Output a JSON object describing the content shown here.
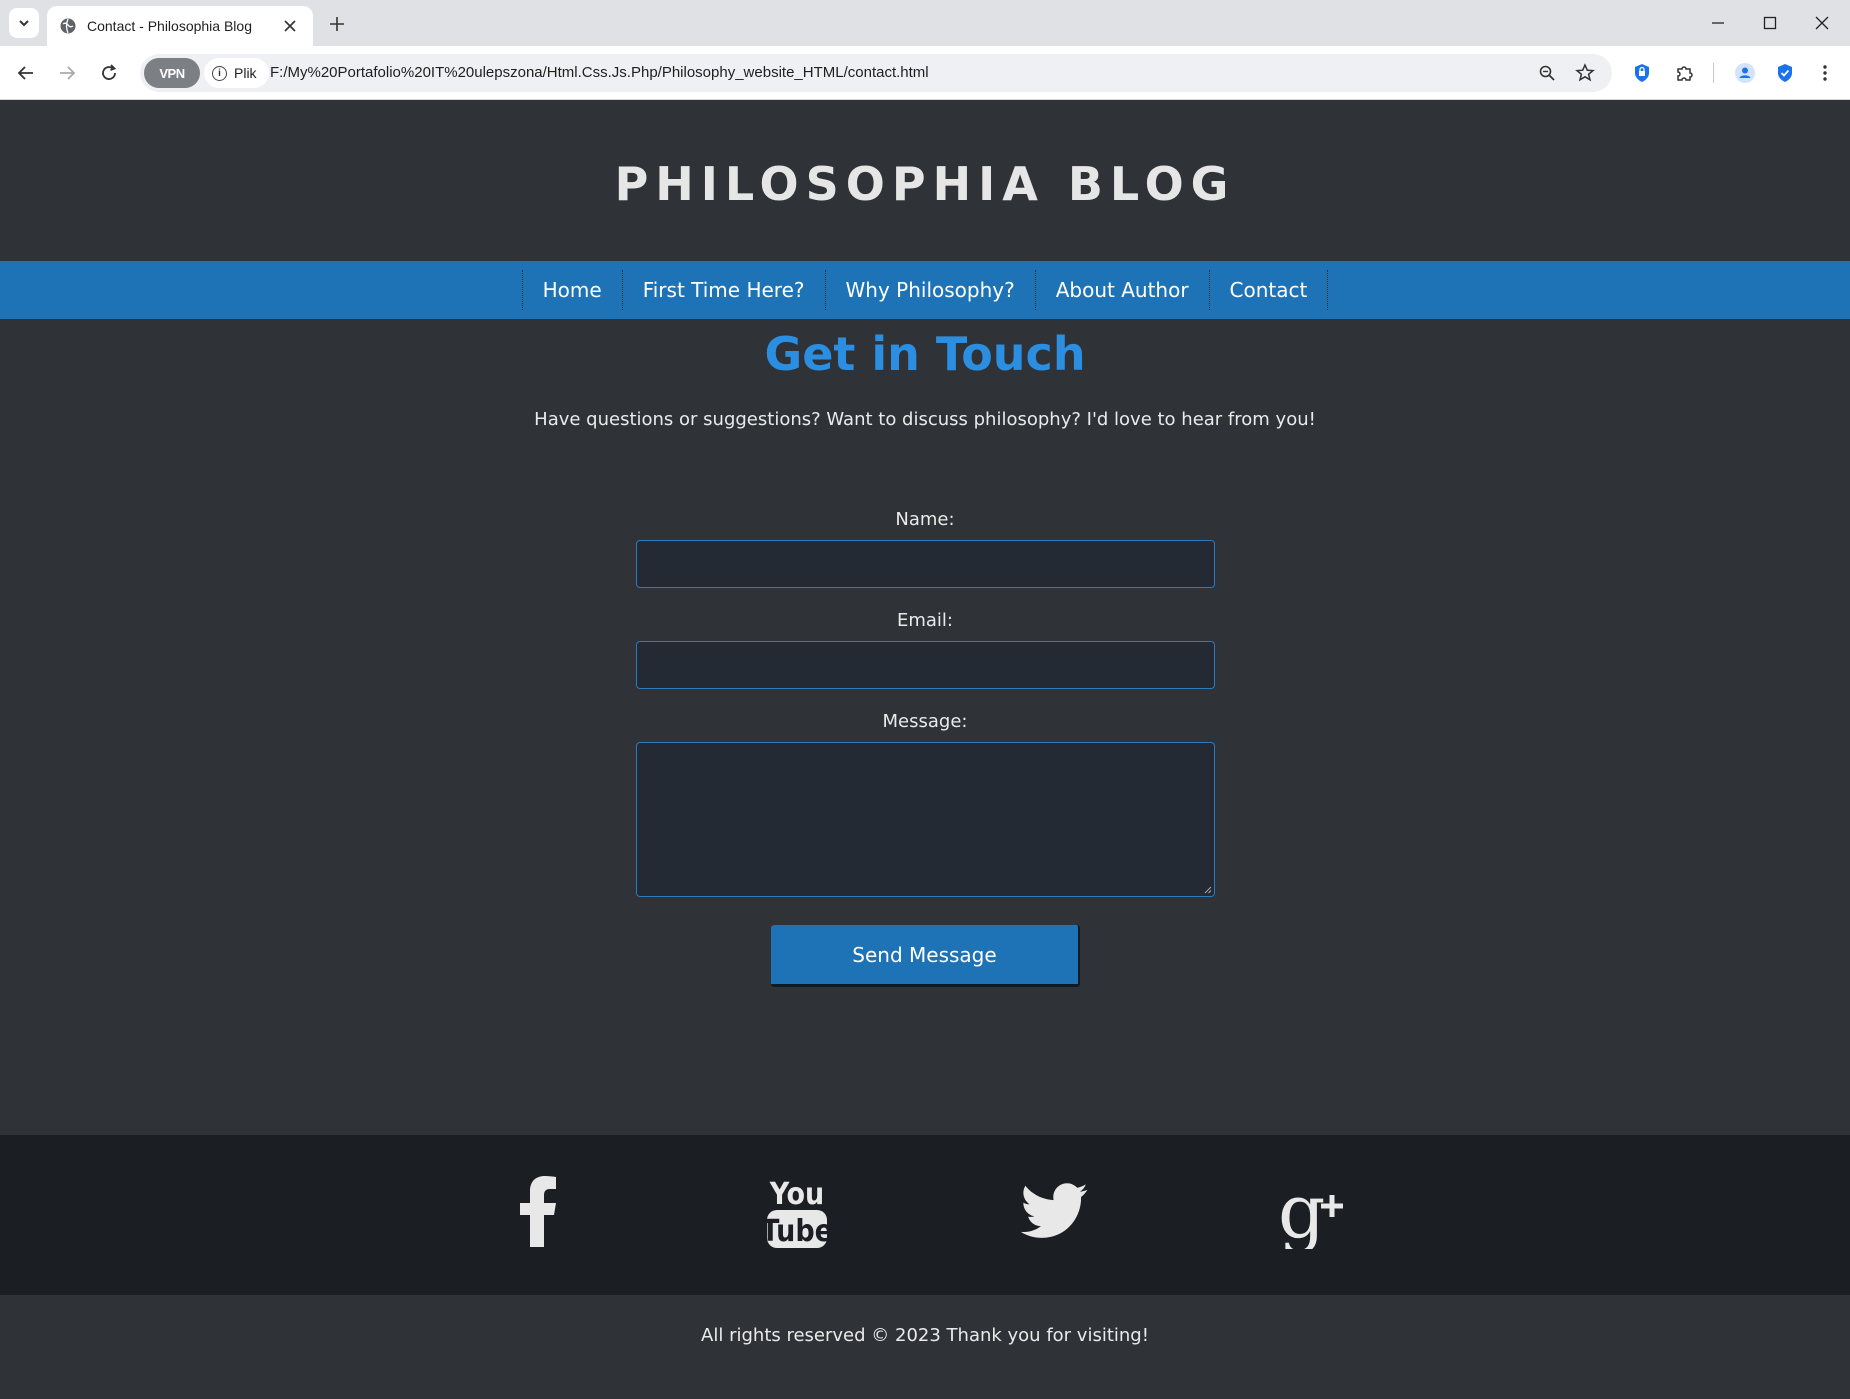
{
  "browser": {
    "tab_title": "Contact - Philosophia Blog",
    "url_chip_label": "Plik",
    "vpn_label": "VPN",
    "url": "F:/My%20Portafolio%20IT%20ulepszona/Html.Css.Js.Php/Philosophy_website_HTML/contact.html",
    "icons": [
      "tab-search-icon",
      "globe-icon",
      "close-icon",
      "plus-icon",
      "minimize-icon",
      "maximize-icon",
      "back-arrow-icon",
      "forward-arrow-icon",
      "reload-icon",
      "info-icon",
      "zoom-icon",
      "star-icon",
      "shield-icon",
      "puzzle-icon",
      "profile-icon",
      "shield-check-icon",
      "kebab-menu-icon"
    ]
  },
  "site": {
    "title": "PHILOSOPHIA BLOG"
  },
  "nav": {
    "items": [
      {
        "label": "Home"
      },
      {
        "label": "First Time Here?"
      },
      {
        "label": "Why Philosophy?"
      },
      {
        "label": "About Author"
      },
      {
        "label": "Contact"
      }
    ]
  },
  "contact": {
    "heading": "Get in Touch",
    "intro": "Have questions or suggestions? Want to discuss philosophy? I'd love to hear from you!",
    "name_label": "Name:",
    "name_value": "",
    "email_label": "Email:",
    "email_value": "",
    "message_label": "Message:",
    "message_value": "",
    "submit_label": "Send Message"
  },
  "social": {
    "icons": [
      "facebook-icon",
      "youtube-icon",
      "twitter-icon",
      "google-plus-icon"
    ]
  },
  "footer": {
    "text": "All rights reserved © 2023 Thank you for visiting!"
  },
  "colors": {
    "page_bg": "#2f3337",
    "nav_bg": "#1e73b6",
    "heading": "#2b8ee0",
    "social_bar_bg": "#1b1e22",
    "field_bg": "#232a33",
    "field_border": "#2a7bc0"
  }
}
